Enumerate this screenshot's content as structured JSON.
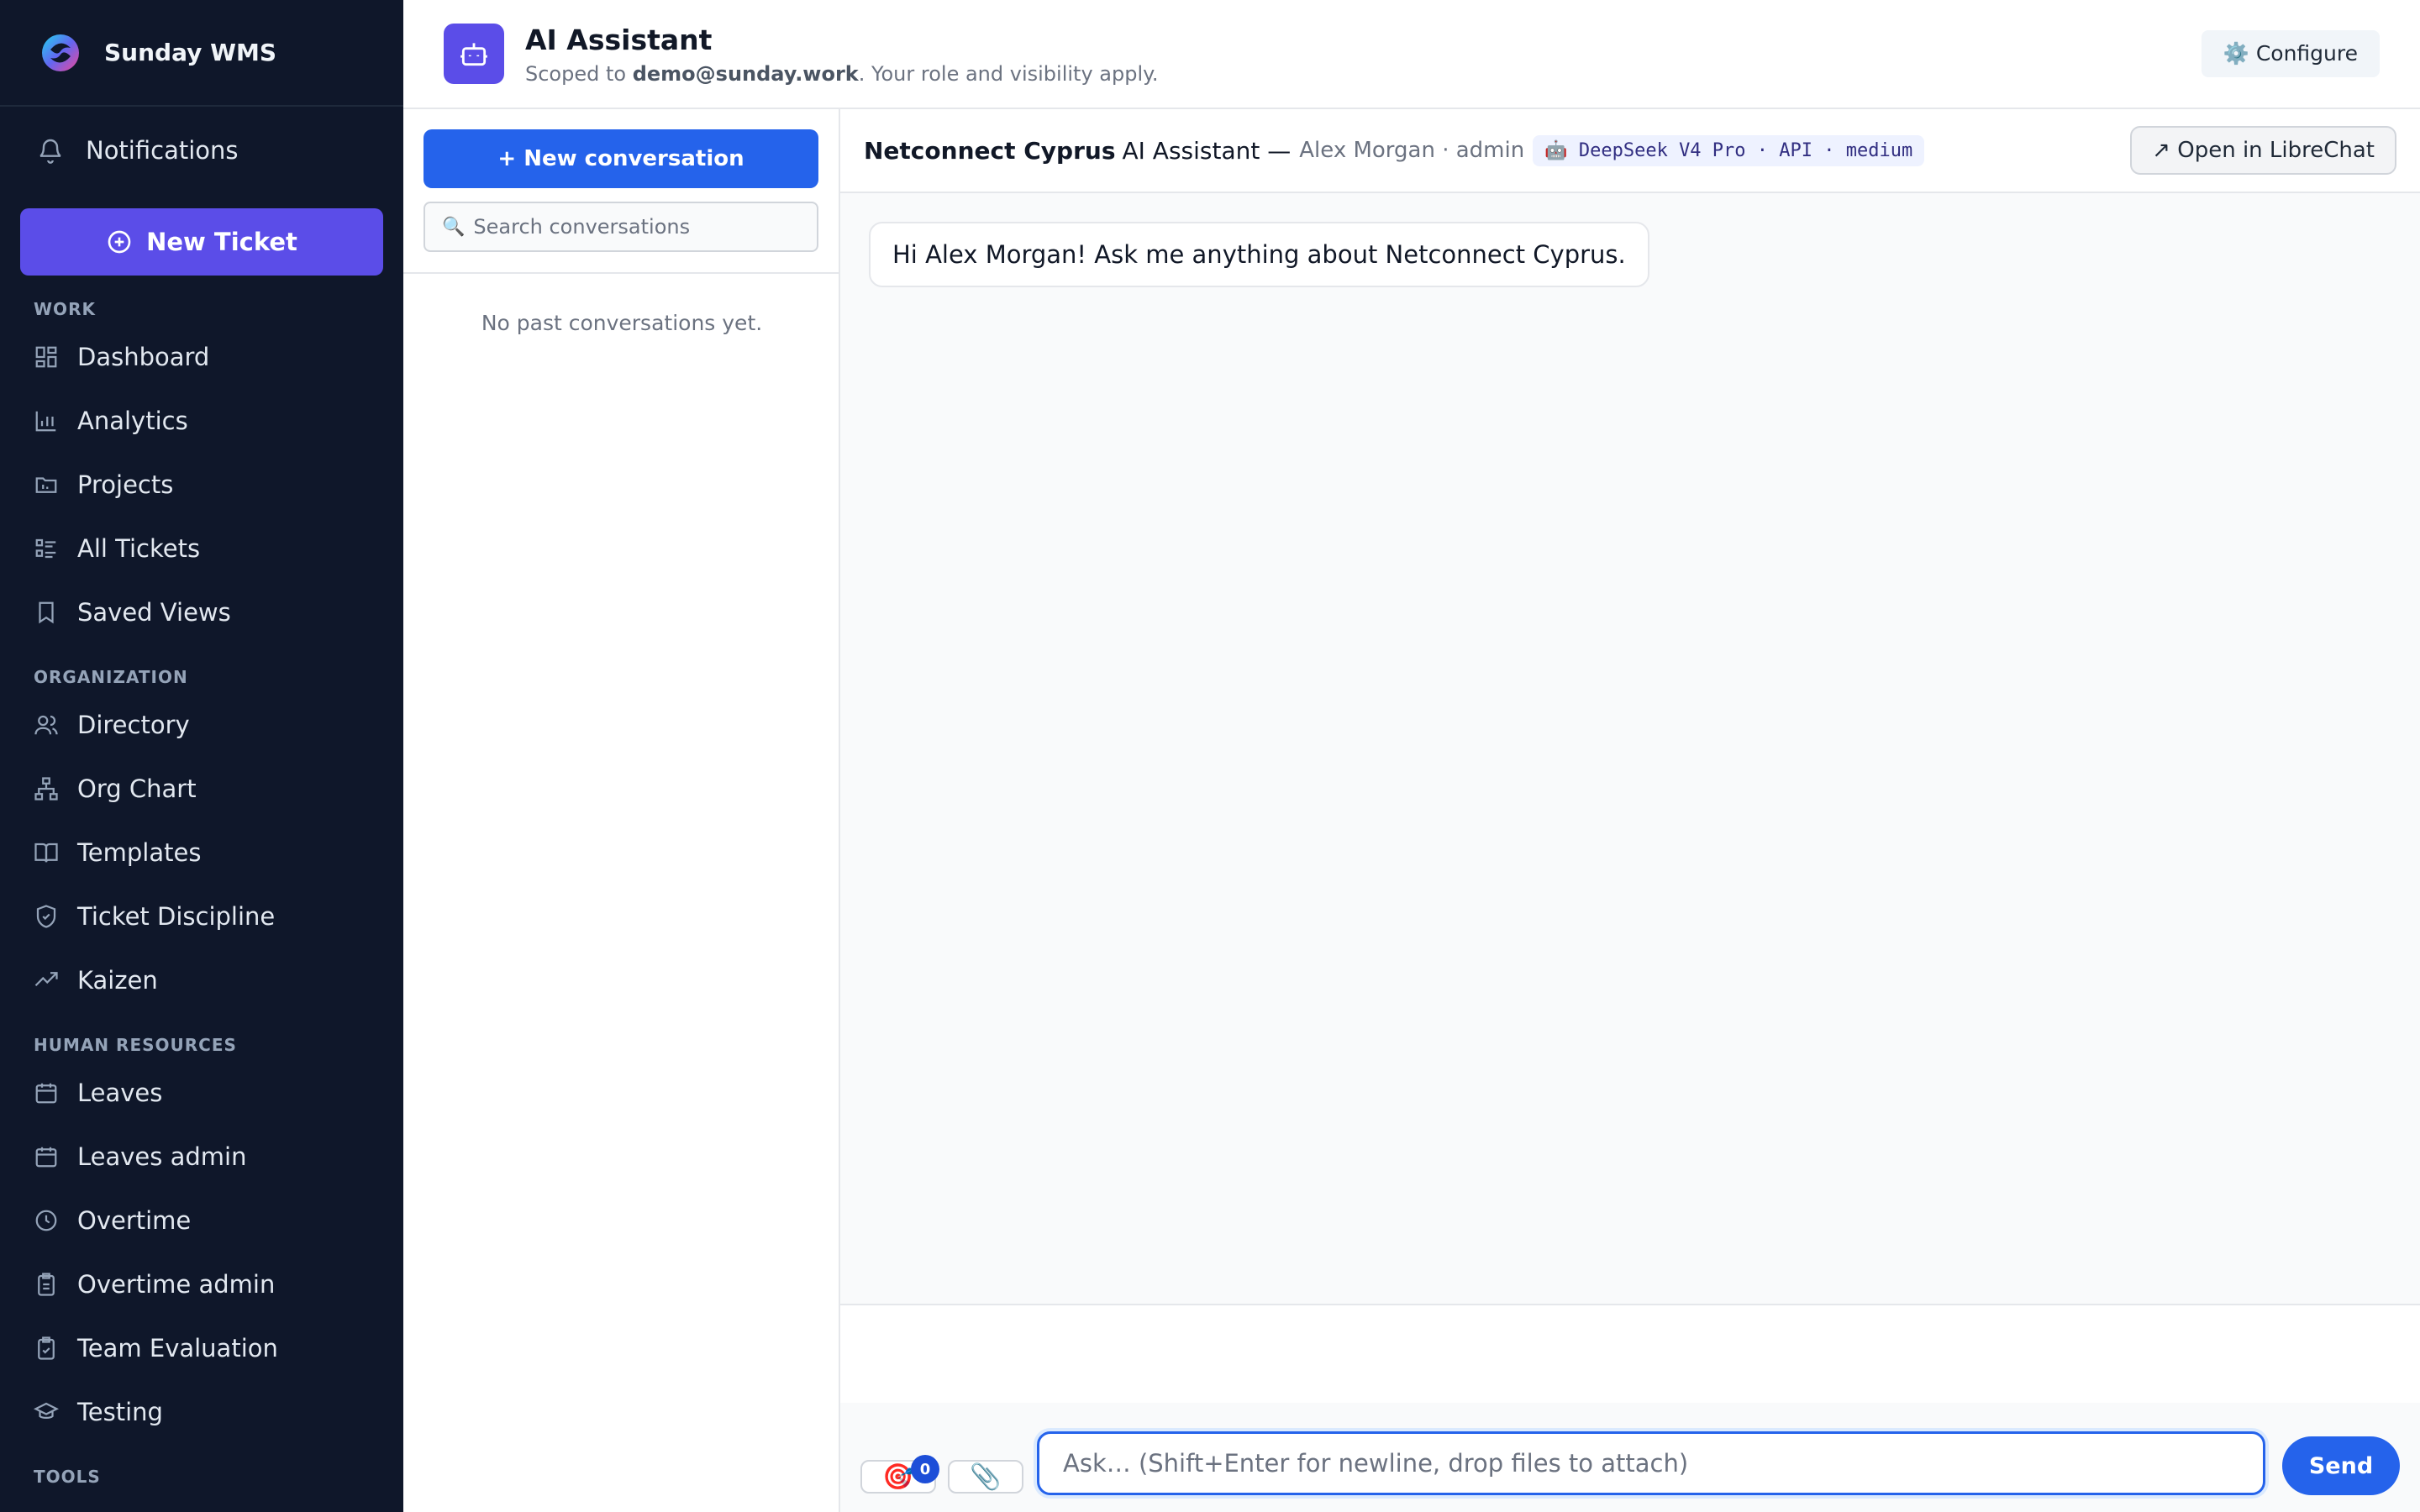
{
  "app": {
    "name": "Sunday WMS",
    "logo_icon": "swirl-logo-icon"
  },
  "sidebar": {
    "notifications_label": "Notifications",
    "new_ticket_label": "New Ticket",
    "sections": {
      "work": "WORK",
      "organization": "ORGANIZATION",
      "human_resources": "HUMAN RESOURCES",
      "tools": "TOOLS"
    },
    "work_items": [
      {
        "label": "Dashboard",
        "icon": "grid-icon"
      },
      {
        "label": "Analytics",
        "icon": "bar-chart-icon"
      },
      {
        "label": "Projects",
        "icon": "folder-icon"
      },
      {
        "label": "All Tickets",
        "icon": "list-icon"
      },
      {
        "label": "Saved Views",
        "icon": "bookmark-icon"
      }
    ],
    "org_items": [
      {
        "label": "Directory",
        "icon": "users-icon"
      },
      {
        "label": "Org Chart",
        "icon": "org-chart-icon"
      },
      {
        "label": "Templates",
        "icon": "book-icon"
      },
      {
        "label": "Ticket Discipline",
        "icon": "shield-icon"
      },
      {
        "label": "Kaizen",
        "icon": "trending-up-icon"
      }
    ],
    "hr_items": [
      {
        "label": "Leaves",
        "icon": "calendar-icon"
      },
      {
        "label": "Leaves admin",
        "icon": "calendar-icon"
      },
      {
        "label": "Overtime",
        "icon": "clock-icon"
      },
      {
        "label": "Overtime admin",
        "icon": "clipboard-icon"
      },
      {
        "label": "Team Evaluation",
        "icon": "clipboard-check-icon"
      },
      {
        "label": "Testing",
        "icon": "graduation-cap-icon"
      }
    ]
  },
  "header": {
    "title": "AI Assistant",
    "subtitle_prefix": "Scoped to ",
    "subtitle_email": "demo@sunday.work",
    "subtitle_suffix": ". Your role and visibility apply.",
    "configure_label": "⚙️ Configure"
  },
  "conversations": {
    "new_label": "+ New conversation",
    "search_placeholder": "Search conversations",
    "empty_text": "No past conversations yet."
  },
  "chat": {
    "org_name": "Netconnect Cyprus",
    "assistant_label": "AI Assistant —",
    "user_info": "Alex Morgan · admin",
    "model_label": "🤖 DeepSeek V4 Pro · API · medium",
    "open_librechat_label": "↗ Open in LibreChat",
    "greeting": "Hi Alex Morgan! Ask me anything about Netconnect Cyprus.",
    "input_placeholder": "Ask… (Shift+Enter for newline, drop files to attach)",
    "input_value": "",
    "send_label": "Send",
    "target_badge_count": "0",
    "target_button_icon": "🎯",
    "attach_button_icon": "📎"
  },
  "colors": {
    "sidebar_bg": "#0f172a",
    "accent_purple": "#5b4de8",
    "accent_blue": "#2563eb"
  }
}
